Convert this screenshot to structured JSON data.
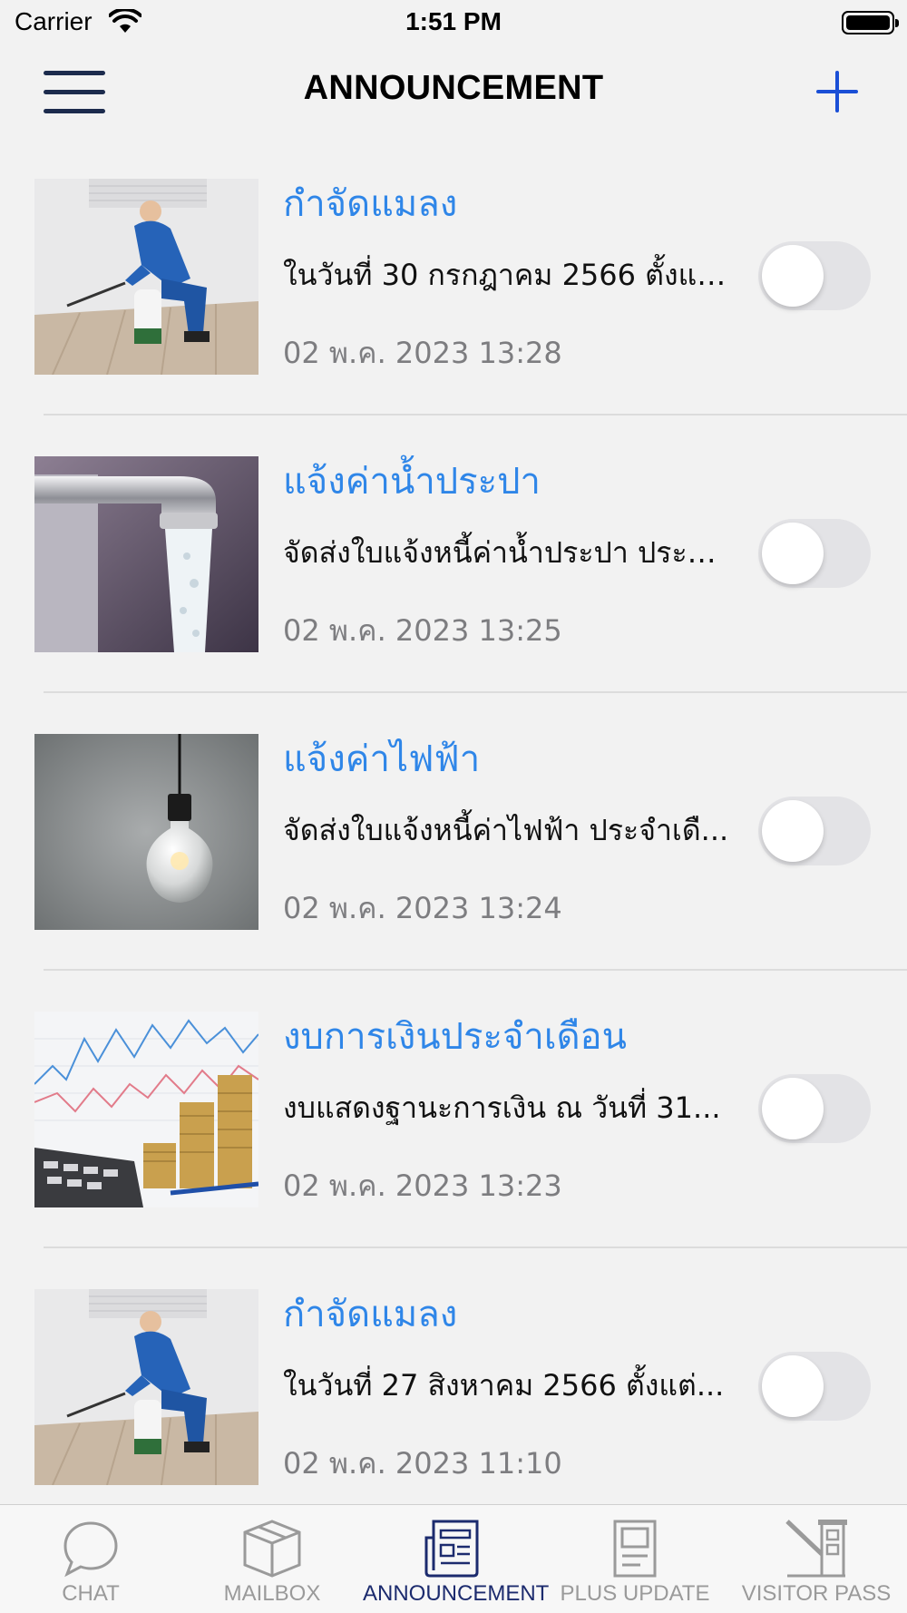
{
  "status_bar": {
    "carrier": "Carrier",
    "time": "1:51 PM"
  },
  "nav": {
    "title": "ANNOUNCEMENT",
    "menu_icon": "hamburger-menu-icon",
    "add_icon": "plus-icon"
  },
  "colors": {
    "accent": "#2f86e8",
    "nav_icon": "#1c2b4d",
    "add_icon": "#1a4fd6",
    "tab_active": "#1c2b6e",
    "tab_inactive": "#9a9a9a"
  },
  "announcements": [
    {
      "title": "กำจัดแมลง",
      "description": "ในวันที่ 30 กรกฎาคม 2566 ตั้งแต่...",
      "date": "02 พ.ค. 2023 13:28",
      "image": "pest-control-worker-image",
      "toggle_on": false
    },
    {
      "title": "แจ้งค่าน้ำประปา",
      "description": "จัดส่งใบแจ้งหนี้ค่าน้ำประปา ประจำ...",
      "date": "02 พ.ค. 2023 13:25",
      "image": "water-faucet-image",
      "toggle_on": false
    },
    {
      "title": "แจ้งค่าไฟฟ้า",
      "description": "จัดส่งใบแจ้งหนี้ค่าไฟฟ้า ประจำเดื...",
      "date": "02 พ.ค. 2023 13:24",
      "image": "light-bulb-image",
      "toggle_on": false
    },
    {
      "title": "งบการเงินประจำเดือน",
      "description": "งบแสดงฐานะการเงิน ณ วันที่ 31...",
      "date": "02 พ.ค. 2023 13:23",
      "image": "finance-coins-calculator-image",
      "toggle_on": false
    },
    {
      "title": "กำจัดแมลง",
      "description": "ในวันที่ 27 สิงหาคม 2566 ตั้งแต่...",
      "date": "02 พ.ค. 2023 11:10",
      "image": "pest-control-worker-image",
      "toggle_on": false
    }
  ],
  "tabs": [
    {
      "label": "CHAT",
      "icon": "chat-bubble-icon",
      "active": false
    },
    {
      "label": "MAILBOX",
      "icon": "box-icon",
      "active": false
    },
    {
      "label": "ANNOUNCEMENT",
      "icon": "newspaper-icon",
      "active": true
    },
    {
      "label": "PLUS UPDATE",
      "icon": "document-icon",
      "active": false
    },
    {
      "label": "VISITOR PASS",
      "icon": "barrier-gate-icon",
      "active": false
    }
  ]
}
